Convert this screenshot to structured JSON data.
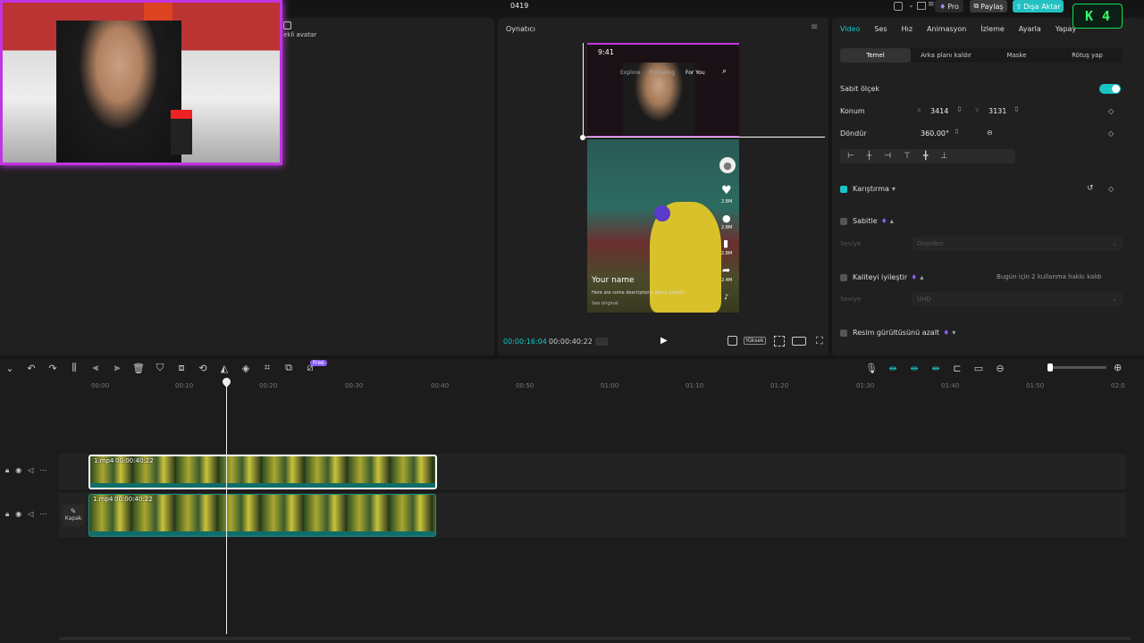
{
  "topbar": {
    "project_title": "0419",
    "pro_label": "Pro",
    "share_label": "Paylaş",
    "export_label": "Dışa Aktar",
    "badge_text": "4"
  },
  "media": {
    "avatar_label": "ekli avatar"
  },
  "player": {
    "title": "Oynatıcı",
    "current_time": "00:00:16:04",
    "total_time": "00:00:40:22",
    "quality_label": "Yüksek",
    "phone": {
      "clock": "9:41",
      "tabs": [
        "Explore",
        "Following",
        "For You"
      ],
      "username": "Your name",
      "caption": "Here are some descriptions about project",
      "see_original": "See original",
      "likes": "2.8M",
      "comments": "2.8M",
      "saves": "2.8M",
      "shares": "2.4M"
    }
  },
  "inspector": {
    "tabs": [
      "Video",
      "Ses",
      "Hız",
      "Animasyon",
      "İzleme",
      "Ayarla",
      "Yapay"
    ],
    "subtabs": [
      "Temel",
      "Arka planı kaldır",
      "Maske",
      "Rötuş yap"
    ],
    "fixed_scale_label": "Sabit ölçek",
    "position_label": "Konum",
    "x_label": "X",
    "x_value": "3414",
    "y_label": "Y",
    "y_value": "3131",
    "rotate_label": "Döndür",
    "rotate_value": "360.00°",
    "blend_label": "Karıştırma",
    "stabilize_label": "Sabitle",
    "level_label": "Seviye",
    "recommended_label": "Önerilen",
    "enhance_label": "Kaliteyi iyileştir",
    "enhance_note": "Bugün için 2 kullanma hakkı kaldı",
    "uhd_label": "UHD",
    "denoise_label": "Resim gürültüsünü azalt"
  },
  "timeline": {
    "free_badge": "Free",
    "ruler": [
      "00:00",
      "00:10",
      "00:20",
      "00:30",
      "00:40",
      "00:50",
      "01:00",
      "01:10",
      "01:20",
      "01:30",
      "01:40",
      "01:50",
      "02:0"
    ],
    "clip1_name": "1.mp4",
    "clip1_duration": "00:00:40:22",
    "clip2_name": "1.mp4",
    "clip2_duration": "00:00:40:22",
    "cover_label": "Kapak"
  },
  "colors": {
    "accent": "#19c4c4",
    "premium": "#8b5cf6",
    "export": "#23c1c1"
  }
}
